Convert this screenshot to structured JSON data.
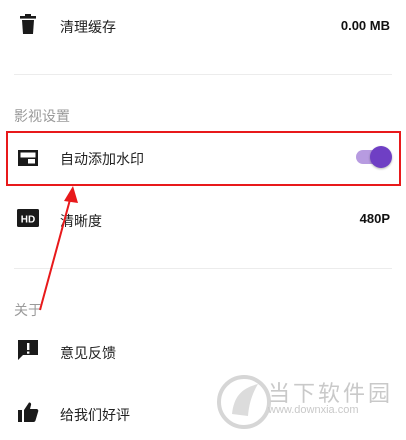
{
  "cache": {
    "label": "清理缓存",
    "value": "0.00 MB",
    "icon": "trash-icon"
  },
  "video_section": {
    "title": "影视设置"
  },
  "watermark_setting": {
    "label": "自动添加水印",
    "icon": "picture-in-picture-icon",
    "enabled": true
  },
  "clarity": {
    "label": "清晰度",
    "value": "480P",
    "icon": "hd-icon"
  },
  "about_section": {
    "title": "关于"
  },
  "feedback": {
    "label": "意见反馈",
    "icon": "feedback-icon"
  },
  "rate": {
    "label": "给我们好评",
    "icon": "thumbs-up-icon"
  },
  "site_watermark": {
    "text": "当下软件园",
    "url": "www.downxia.com"
  },
  "colors": {
    "highlight": "#e8191b",
    "toggle_thumb": "#6f3fc4",
    "toggle_track": "#b79be0"
  }
}
